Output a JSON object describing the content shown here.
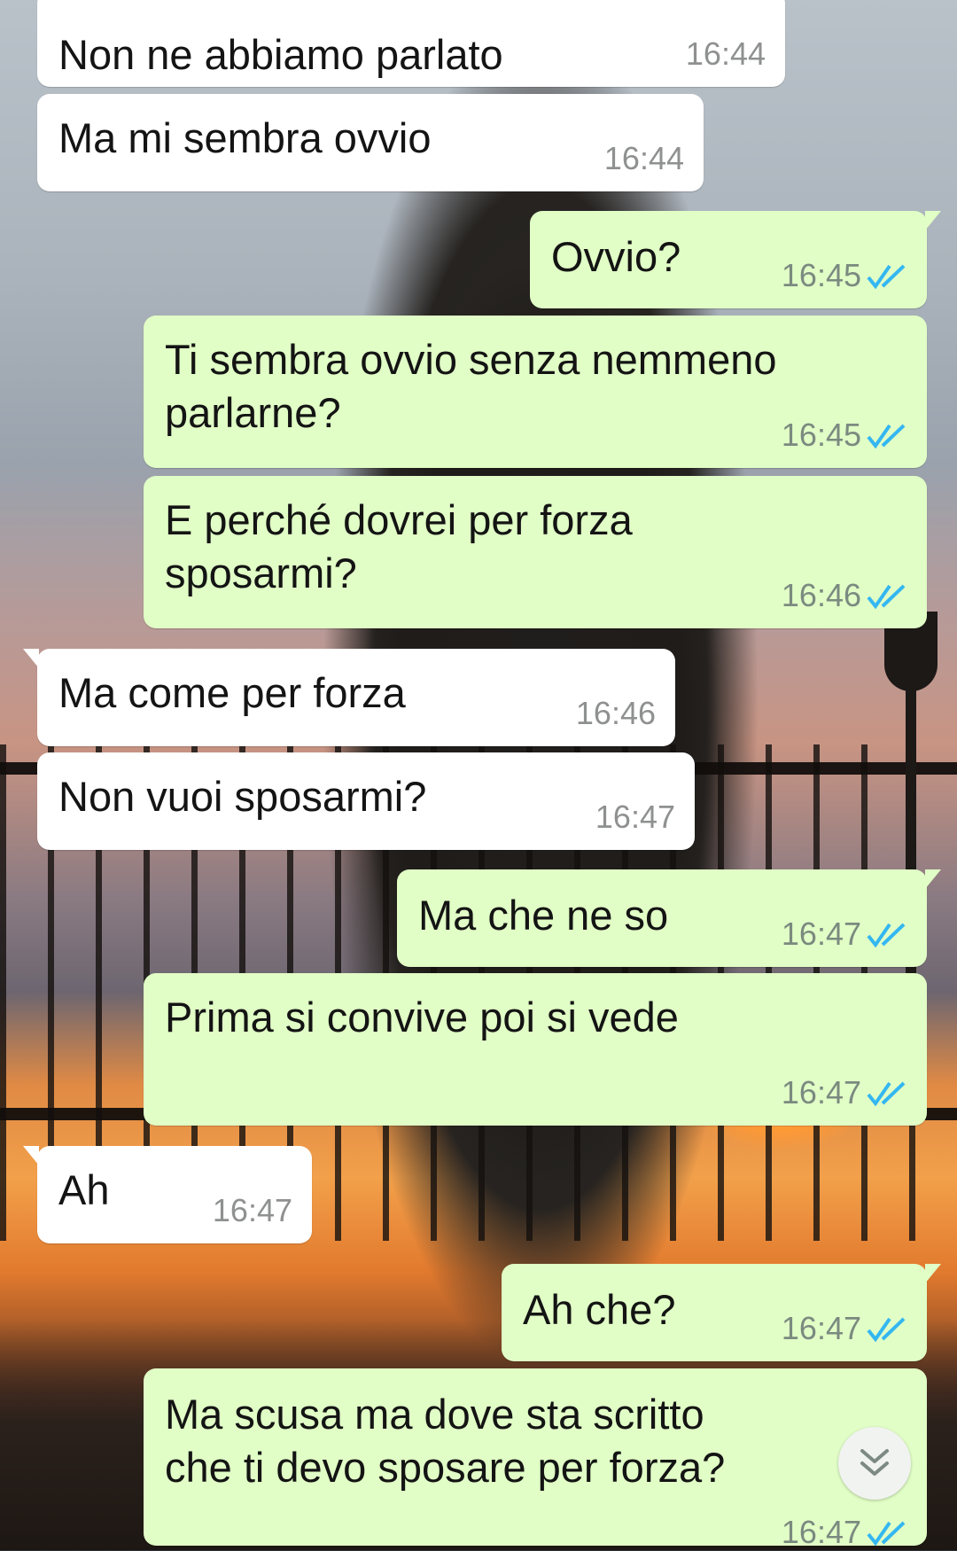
{
  "chat": {
    "messages": [
      {
        "dir": "in",
        "text": "Non ne abbiamo parlato",
        "time": "16:44"
      },
      {
        "dir": "in",
        "text": "Ma mi sembra ovvio",
        "time": "16:44"
      },
      {
        "dir": "out",
        "text": "Ovvio?",
        "time": "16:45",
        "status": "read"
      },
      {
        "dir": "out",
        "text": "Ti sembra ovvio senza nemmeno\nparlarne?",
        "time": "16:45",
        "status": "read"
      },
      {
        "dir": "out",
        "text": "E perché dovrei per forza\nsposarmi?",
        "time": "16:46",
        "status": "read"
      },
      {
        "dir": "in",
        "text": "Ma come per forza",
        "time": "16:46"
      },
      {
        "dir": "in",
        "text": "Non vuoi sposarmi?",
        "time": "16:47"
      },
      {
        "dir": "out",
        "text": "Ma che ne so",
        "time": "16:47",
        "status": "read"
      },
      {
        "dir": "out",
        "text": "Prima si convive poi si vede",
        "time": "16:47",
        "status": "read"
      },
      {
        "dir": "in",
        "text": "Ah",
        "time": "16:47"
      },
      {
        "dir": "out",
        "text": "Ah che?",
        "time": "16:47",
        "status": "read"
      },
      {
        "dir": "out",
        "text": "Ma scusa ma dove sta scritto\nche ti devo sposare per forza?",
        "time": "16:47",
        "status": "read"
      }
    ],
    "read_tick_color": "#34b7f1"
  },
  "scroll_down_button": {
    "icon": "chevron-double-down-icon"
  }
}
